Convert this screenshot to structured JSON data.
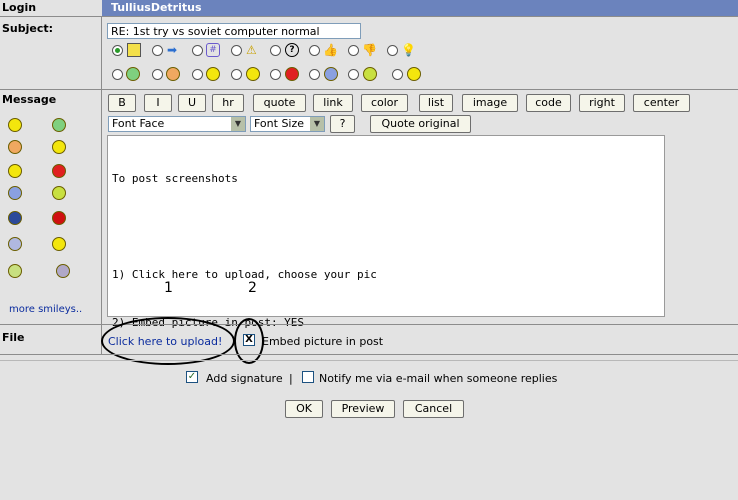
{
  "header": {
    "login_label": "Login",
    "username": "TulliusDetritus"
  },
  "subject": {
    "label": "Subject:",
    "value": "RE: 1st try vs soviet computer normal",
    "icons_row1": [
      "note-icon",
      "arrow-icon",
      "hash-icon",
      "warning-icon",
      "question-icon",
      "thumbs-up-icon",
      "thumbs-down-icon",
      "lightbulb-icon"
    ],
    "icons_row2": [
      "grin-smiley-icon",
      "cool-smiley-icon",
      "smile-smiley-icon",
      "confused-smiley-icon",
      "angry-smiley-icon",
      "sad-smiley-icon",
      "happy-smiley-icon",
      "wink-smiley-icon"
    ]
  },
  "message": {
    "label": "Message",
    "more_smileys": "more smileys..",
    "toolbar": [
      "B",
      "I",
      "U",
      "hr",
      "quote",
      "link",
      "color",
      "list",
      "image",
      "code",
      "right",
      "center"
    ],
    "font_face": "Font Face",
    "font_size": "Font Size",
    "help_btn": "?",
    "quote_original": "Quote original",
    "body_lines": [
      "To post screenshots",
      "",
      "1) Click here to upload, choose your pic",
      "2) Embed picture in post: YES"
    ]
  },
  "annotations": {
    "one": "1",
    "two": "2"
  },
  "file": {
    "label": "File",
    "upload_link": "Click here to upload!",
    "embed_checked_mark": "X",
    "embed_label": "Embed picture in post"
  },
  "options": {
    "add_signature": "Add signature",
    "separator": "|",
    "notify": "Notify me via e-mail when someone replies",
    "check_mark": "✓"
  },
  "actions": {
    "ok": "OK",
    "preview": "Preview",
    "cancel": "Cancel"
  }
}
